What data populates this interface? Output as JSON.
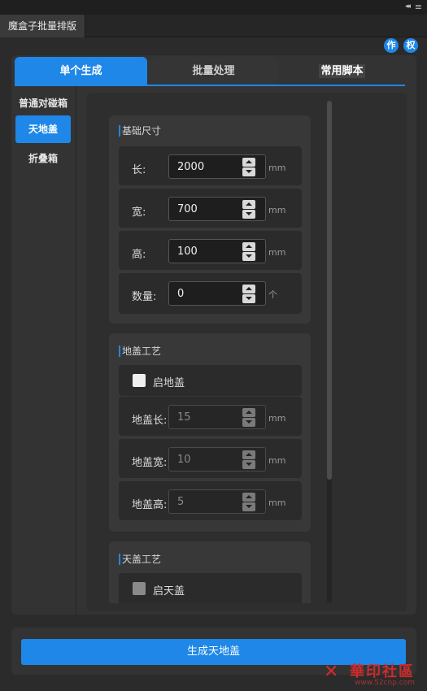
{
  "panel": {
    "tab_label": "魔盒子批量排版",
    "icon_zuo": "作",
    "icon_quan": "权"
  },
  "tabs": [
    "单个生成",
    "批量处理",
    "常用脚本"
  ],
  "leftnav": [
    "普通对碰箱",
    "天地盖",
    "折叠箱"
  ],
  "sections": {
    "basic": {
      "title": "基础尺寸",
      "rows": [
        {
          "label": "长:",
          "value": "2000",
          "unit": "mm"
        },
        {
          "label": "宽:",
          "value": "700",
          "unit": "mm"
        },
        {
          "label": "高:",
          "value": "100",
          "unit": "mm"
        },
        {
          "label": "数量:",
          "value": "0",
          "unit": "个"
        }
      ]
    },
    "bottom_lid": {
      "title": "地盖工艺",
      "enable_label": "启地盖",
      "rows": [
        {
          "label": "地盖长:",
          "value": "15",
          "unit": "mm"
        },
        {
          "label": "地盖宽:",
          "value": "10",
          "unit": "mm"
        },
        {
          "label": "地盖高:",
          "value": "5",
          "unit": "mm"
        }
      ]
    },
    "top_lid": {
      "title": "天盖工艺",
      "enable_label": "启天盖"
    }
  },
  "generate_button": "生成天地盖",
  "watermark": {
    "text": "華印社區",
    "url": "www.52cnp.com"
  },
  "colors": {
    "accent": "#1e87e8",
    "background": "#2b2b2b",
    "watermark": "#d02b2b"
  }
}
